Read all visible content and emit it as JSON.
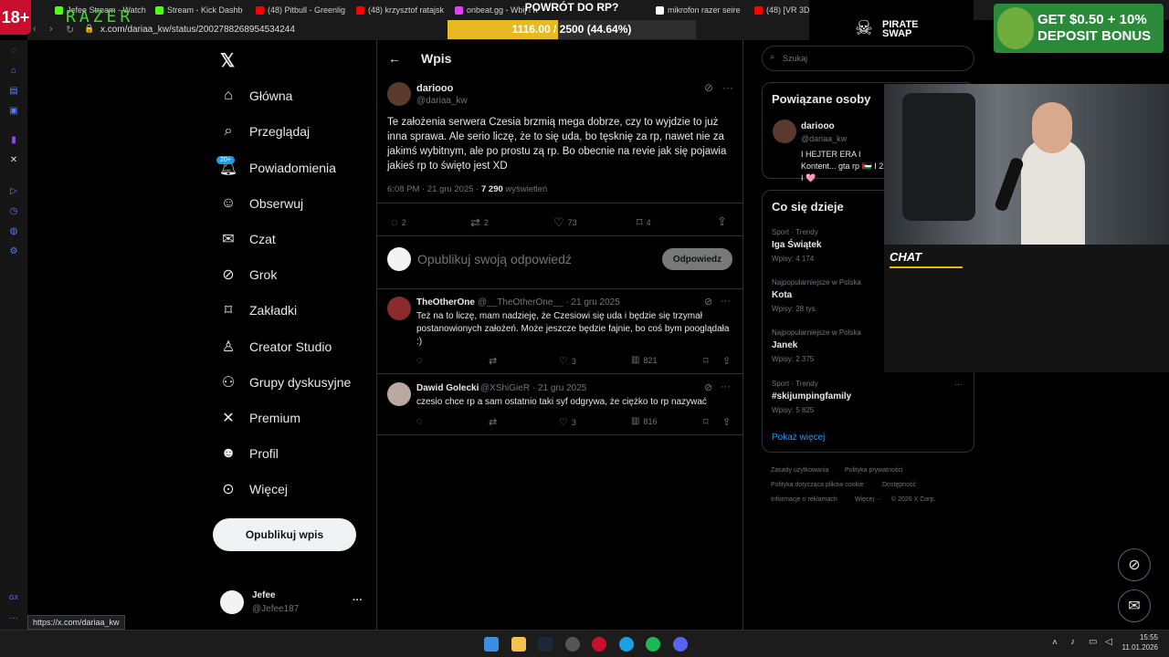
{
  "browser": {
    "tabs": [
      {
        "label": "Jefee Stream - Watch",
        "color": "#53fc18"
      },
      {
        "label": "Stream - Kick Dashb",
        "color": "#53fc18"
      },
      {
        "label": "(48) Pitbull - Greenlig",
        "color": "#ff0000"
      },
      {
        "label": "(48) krzysztof ratajsk",
        "color": "#ff0000"
      },
      {
        "label": "onbeat.gg - Wbij i n",
        "color": "#e040fb"
      },
      {
        "label": "mikrofon razer seire",
        "color": "#ffffff"
      },
      {
        "label": "(48) [VR 3D",
        "color": "#ff0000"
      }
    ],
    "url": "x.com/dariaa_kw/status/2002788268954534244",
    "status_url": "https://x.com/dariaa_kw"
  },
  "overlay": {
    "age_badge": "18+",
    "brand": "RAZER",
    "goal_title": "POWRÓT DO RP?",
    "goal_text": "1116.00 / 2500 (44.64%)",
    "goal_progress": 0.4464,
    "pirate_label": "PIRATE SWAP",
    "ad_text": "GET $0.50 + 10% DEPOSIT BONUS",
    "chat_label": "CHAT"
  },
  "nav": {
    "items": [
      {
        "label": "Główna",
        "icon": "home-icon"
      },
      {
        "label": "Przeglądaj",
        "icon": "search-icon"
      },
      {
        "label": "Powiadomienia",
        "icon": "bell-icon",
        "badge": "20+"
      },
      {
        "label": "Obserwuj",
        "icon": "follow-icon"
      },
      {
        "label": "Czat",
        "icon": "mail-icon"
      },
      {
        "label": "Grok",
        "icon": "grok-icon"
      },
      {
        "label": "Zakładki",
        "icon": "bookmark-icon"
      },
      {
        "label": "Creator Studio",
        "icon": "creator-icon"
      },
      {
        "label": "Grupy dyskusyjne",
        "icon": "groups-icon"
      },
      {
        "label": "Premium",
        "icon": "x-icon"
      },
      {
        "label": "Profil",
        "icon": "profile-icon"
      },
      {
        "label": "Więcej",
        "icon": "more-icon"
      }
    ],
    "post_button": "Opublikuj wpis",
    "account_name": "Jefee",
    "account_handle": "@Jefee187"
  },
  "post": {
    "header": "Wpis",
    "author": "dariooo",
    "handle": "@dariaa_kw",
    "text": "Te założenia serwera Czesia brzmią mega dobrze, czy to wyjdzie to już inna sprawa. Ale serio liczę, że to się uda, bo tęsknię za rp, nawet nie za jakimś wybitnym, ale po prostu zą rp. Bo obecnie na revie jak się pojawia jakieś rp to święto jest XD",
    "meta_time": "6:08 PM · 21 gru 2025 · ",
    "views": "7 290",
    "views_label": " wyświetleń",
    "replies": "2",
    "reposts": "2",
    "likes": "73",
    "bookmarks": "4"
  },
  "reply_box": {
    "placeholder": "Opublikuj swoją odpowiedź",
    "button": "Odpowiedz"
  },
  "replies": [
    {
      "author": "TheOtherOne",
      "handle": "@__TheOtherOne__ · 21 gru 2025",
      "text": "Też na to liczę, mam nadzieję, że Czesiowi się uda i będzie się trzymał postanowionych założeń. Może jeszcze będzie fajnie, bo coś bym pooglądała :)",
      "likes": "3",
      "views": "821"
    },
    {
      "author": "Dawid Golecki",
      "handle": "@XShiGieR · 21 gru 2025",
      "text": "czesio chce rp a sam ostatnio taki syf odgrywa, że ciężko to rp nazywać",
      "likes": "3",
      "views": "816"
    }
  ],
  "sidebar": {
    "search_placeholder": "Szukaj",
    "related_title": "Powiązane osoby",
    "related_name": "dariooo",
    "related_handle": "@dariaa_kw",
    "related_bio": "I HEJTER ERA I Kontent... gta rp 🇵🇸 I 22 I 🩷",
    "trends_title": "Co się dzieje",
    "trends": [
      {
        "sub": "Sport · Trendy",
        "main": "Iga Świątek",
        "count": "Wpisy: 4 174"
      },
      {
        "sub": "Najpopularniejsze w Polska",
        "main": "Kota",
        "count": "Wpisy: 28 tys."
      },
      {
        "sub": "Najpopularniejsze w Polska",
        "main": "Janek",
        "count": "Wpisy: 2 375"
      },
      {
        "sub": "Sport · Trendy",
        "main": "#skijumpingfamily",
        "count": "Wpisy: 5 825"
      }
    ],
    "show_more": "Pokaż więcej",
    "footer": [
      "Zasady użytkowania",
      "Polityka prywatności",
      "Polityka dotycząca plików cookie",
      "Dostępność",
      "Informacje o reklamach",
      "Więcej ···",
      "© 2026 X Corp."
    ]
  },
  "taskbar": {
    "time": "15:55",
    "date": "11.01.2026"
  }
}
